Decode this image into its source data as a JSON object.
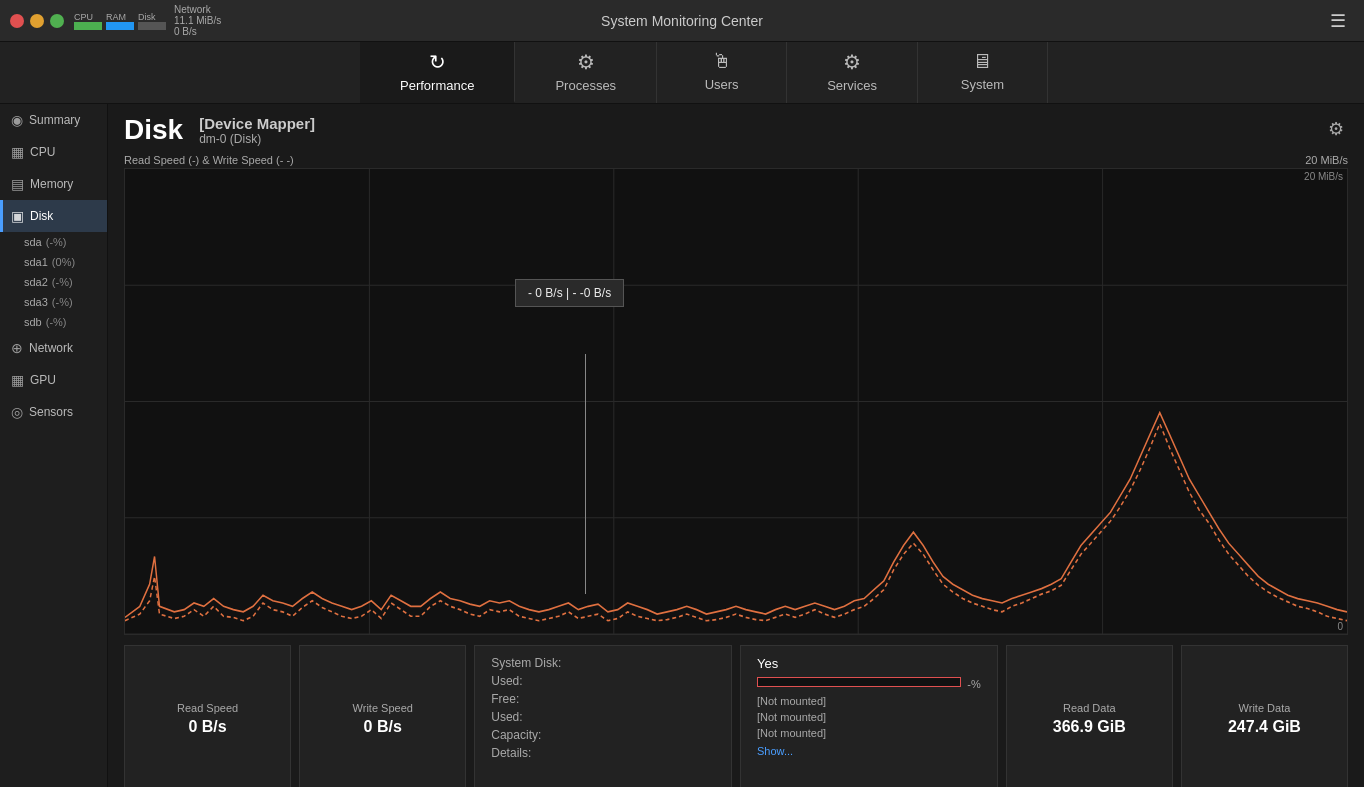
{
  "titlebar": {
    "title": "System Monitoring Center",
    "cpu_label": "CPU",
    "ram_label": "RAM",
    "disk_label": "Disk",
    "net_label": "Network",
    "net_value": "11.1 MiB/s",
    "net_upload": "0 B/s"
  },
  "tabs": [
    {
      "id": "performance",
      "label": "Performance",
      "icon": "⟳",
      "active": true
    },
    {
      "id": "processes",
      "label": "Processes",
      "icon": "⚙",
      "active": false
    },
    {
      "id": "users",
      "label": "Users",
      "icon": "🖱",
      "active": false
    },
    {
      "id": "services",
      "label": "Services",
      "icon": "⚙",
      "active": false
    },
    {
      "id": "system",
      "label": "System",
      "icon": "🖥",
      "active": false
    }
  ],
  "sidebar": {
    "items": [
      {
        "id": "summary",
        "label": "Summary",
        "icon": "◉",
        "active": false
      },
      {
        "id": "cpu",
        "label": "CPU",
        "icon": "▦",
        "active": false
      },
      {
        "id": "memory",
        "label": "Memory",
        "icon": "▤",
        "active": false
      },
      {
        "id": "disk",
        "label": "Disk",
        "icon": "▣",
        "active": true
      },
      {
        "id": "network",
        "label": "Network",
        "icon": "⊕",
        "active": false
      },
      {
        "id": "gpu",
        "label": "GPU",
        "icon": "▦",
        "active": false
      },
      {
        "id": "sensors",
        "label": "Sensors",
        "icon": "◎",
        "active": false
      }
    ],
    "disk_sub": [
      {
        "id": "sda",
        "label": "sda",
        "badge": "(-%)",
        "active": false
      },
      {
        "id": "sda1",
        "label": "sda1",
        "badge": "(0%)",
        "active": false
      },
      {
        "id": "sda2",
        "label": "sda2",
        "badge": "(-%)",
        "active": false
      },
      {
        "id": "sda3",
        "label": "sda3",
        "badge": "(-%)",
        "active": false
      },
      {
        "id": "sdb",
        "label": "sdb",
        "badge": "(-%)",
        "active": false
      }
    ]
  },
  "disk_header": {
    "title": "Disk",
    "device_name": "[Device Mapper]",
    "device_id": "dm-0 (Disk)",
    "gear_label": "⚙"
  },
  "chart": {
    "speed_label": "Read Speed (-) & Write Speed (-  -)",
    "max_label": "20 MiB/s",
    "zero_label": "0",
    "tooltip": "- 0 B/s  |  - -0 B/s"
  },
  "stats": {
    "read_speed_label": "Read Speed",
    "read_speed_value": "0 B/s",
    "write_speed_label": "Write Speed",
    "write_speed_value": "0 B/s",
    "read_data_label": "Read Data",
    "read_data_value": "366.9 GiB",
    "write_data_label": "Write Data",
    "write_data_value": "247.4 GiB"
  },
  "disk_info": {
    "system_disk_label": "System Disk:",
    "used_label": "Used:",
    "free_label": "Free:",
    "used2_label": "Used:",
    "capacity_label": "Capacity:",
    "details_label": "Details:"
  },
  "system_box": {
    "yes_label": "Yes",
    "pct_label": "-%",
    "not_mounted_1": "[Not mounted]",
    "not_mounted_2": "[Not mounted]",
    "not_mounted_3": "[Not mounted]",
    "show_label": "Show..."
  }
}
